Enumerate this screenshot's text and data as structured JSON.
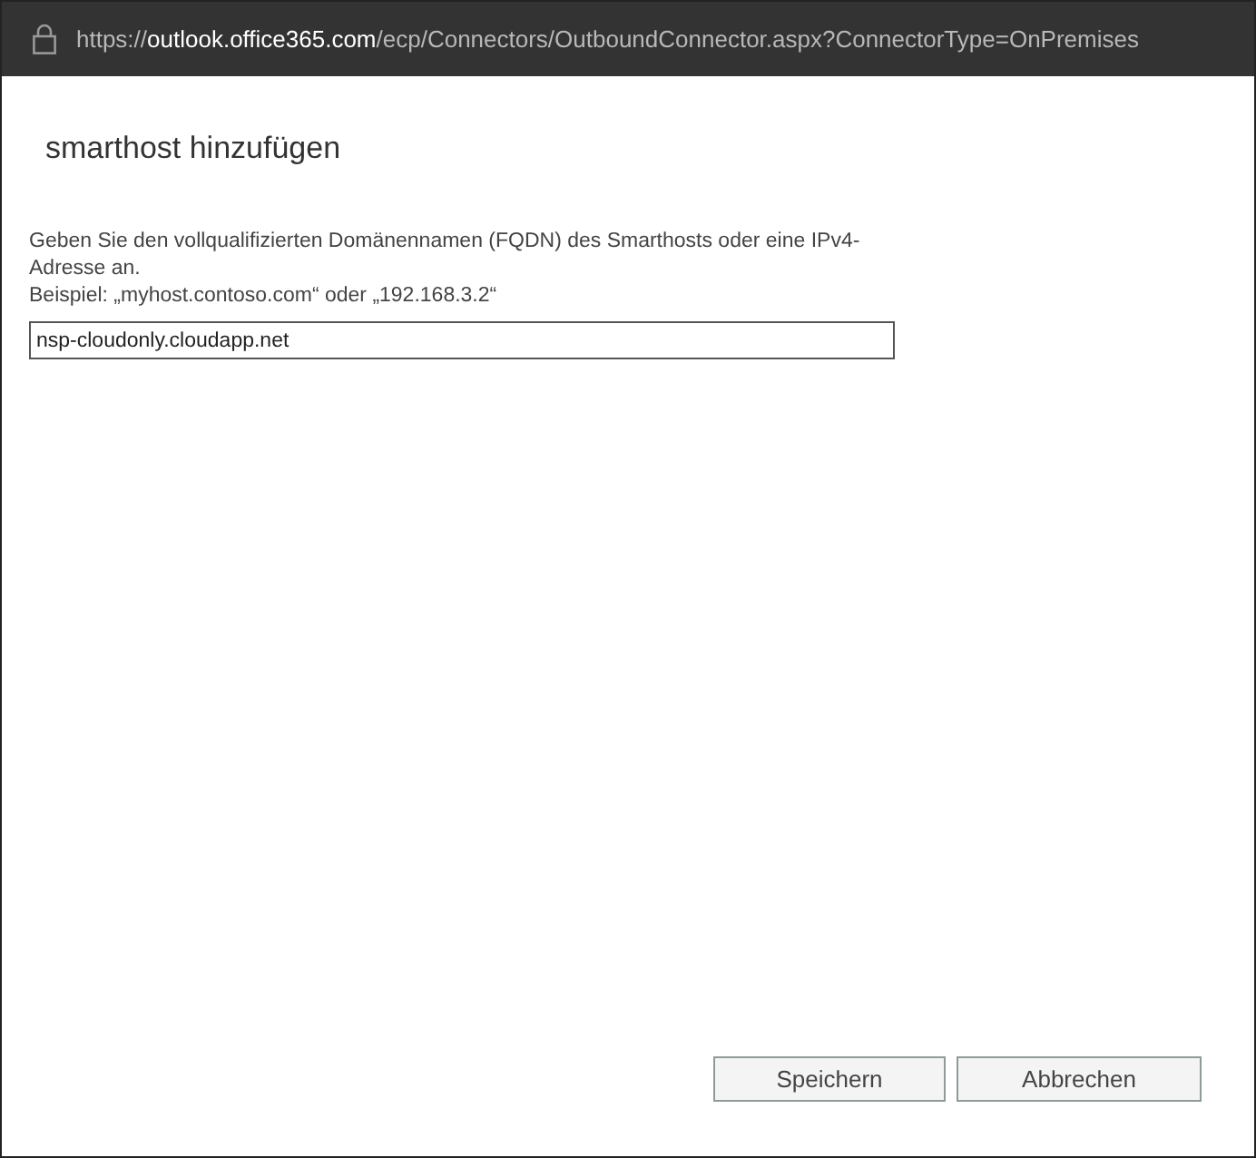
{
  "address_bar": {
    "url": [
      {
        "text": "https://",
        "highlighted": false
      },
      {
        "text": "outlook.office365.com",
        "highlighted": true
      },
      {
        "text": "/ecp/Connectors/OutboundConnector.aspx?ConnectorType=OnPremises",
        "highlighted": false
      }
    ]
  },
  "dialog": {
    "title": "smarthost hinzufügen",
    "instruction_lines": [
      "Geben Sie den vollqualifizierten Domänennamen (FQDN) des Smarthosts oder eine IPv4-",
      "Adresse an."
    ],
    "example": "Beispiel: „myhost.contoso.com“ oder „192.168.3.2“",
    "field": {
      "value": "nsp-cloudonly.cloudapp.net"
    },
    "buttons": [
      {
        "label": "Speichern",
        "kind": "save"
      },
      {
        "label": "Abbrechen",
        "kind": "cancel"
      }
    ]
  }
}
